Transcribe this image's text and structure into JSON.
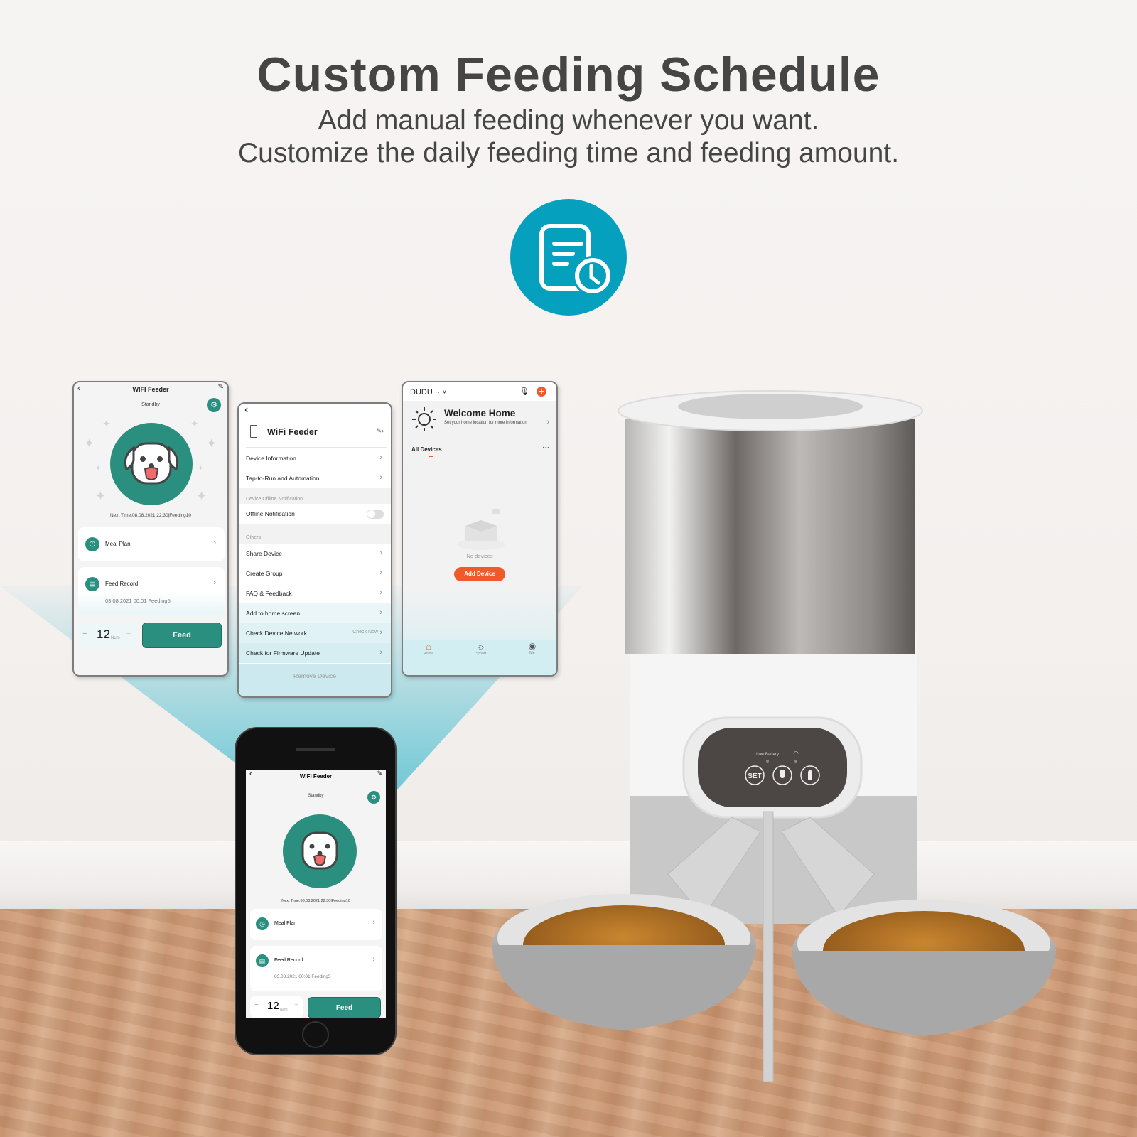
{
  "headline": {
    "title": "Custom Feeding Schedule",
    "subtitle_line1": "Add manual feeding whenever you want.",
    "subtitle_line2": "Customize the daily feeding time and feeding amount.",
    "badge_icon": "document-clock-icon",
    "badge_color": "#05a0bd"
  },
  "colors": {
    "teal": "#2a8f7f",
    "orange": "#ef5a2a",
    "beam": "#5cc3d3",
    "text": "#454545"
  },
  "feeder_screen": {
    "title": "WIFI Feeder",
    "status": "Standby",
    "next_time": "Next Time:08.08.2021 22:30|Feeding10",
    "meal_plan_label": "Meal Plan",
    "feed_record_label": "Feed Record",
    "feed_record_entry": "03.08.2021 00:01 Feeding5",
    "quantity": "12",
    "quantity_unit": "Num",
    "minus": "−",
    "plus": "+",
    "feed_button": "Feed"
  },
  "settings_screen": {
    "device_name": "WiFi Feeder",
    "rows_top": [
      {
        "label": "Device Information"
      },
      {
        "label": "Tap-to-Run and Automation"
      }
    ],
    "section_offline": "Device Offline Notification",
    "offline_row": {
      "label": "Offline Notification",
      "toggle_on": false
    },
    "section_others": "Others",
    "rows_others": [
      {
        "label": "Share Device",
        "value": ""
      },
      {
        "label": "Create Group",
        "value": ""
      },
      {
        "label": "FAQ & Feedback",
        "value": ""
      },
      {
        "label": "Add to home screen",
        "value": ""
      },
      {
        "label": "Check Device Network",
        "value": "Check Now"
      },
      {
        "label": "Check for Firmware Update",
        "value": ""
      }
    ],
    "remove_button": "Remove Device"
  },
  "home_screen": {
    "home_name": "DUDU",
    "welcome_title": "Welcome Home",
    "welcome_sub": "Set your home location for more information",
    "all_devices": "All Devices",
    "more": "···",
    "empty_text": "No devices",
    "add_button": "Add Device",
    "tabs": [
      {
        "label": "Home",
        "icon": "home-icon",
        "active": true
      },
      {
        "label": "Smart",
        "icon": "sun-icon",
        "active": false
      },
      {
        "label": "Me",
        "icon": "user-icon",
        "active": false
      }
    ]
  },
  "device_panel": {
    "low_battery_label": "Low Battery",
    "buttons": [
      {
        "label": "SET",
        "icon": ""
      },
      {
        "label": "",
        "icon": "microphone-icon"
      },
      {
        "label": "",
        "icon": "hand-pointer-icon"
      }
    ]
  }
}
